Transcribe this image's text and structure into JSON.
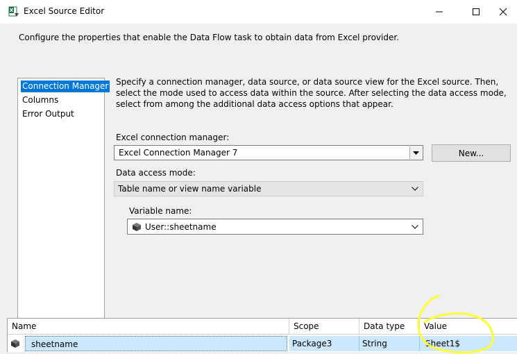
{
  "window": {
    "title": "Excel Source Editor",
    "app_icon": "excel-source-icon",
    "controls": [
      "minimize-icon",
      "maximize-icon",
      "close-icon"
    ]
  },
  "description": "Configure the properties that enable the Data Flow task to obtain data from Excel provider.",
  "nav": {
    "items": [
      {
        "label": "Connection Manager",
        "selected": true
      },
      {
        "label": "Columns",
        "selected": false
      },
      {
        "label": "Error Output",
        "selected": false
      }
    ]
  },
  "instructions": "Specify a connection manager, data source, or data source view for the Excel source. Then, select the mode used to access data within the source. After selecting the data access mode, select from among the additional data access options that appear.",
  "connection_manager": {
    "label": "Excel connection manager:",
    "value": "Excel Connection Manager 7",
    "new_button": "New..."
  },
  "data_access_mode": {
    "label": "Data access mode:",
    "value": "Table name or view name variable"
  },
  "variable": {
    "label": "Variable name:",
    "value": "User::sheetname",
    "icon": "variable-icon"
  },
  "variables_grid": {
    "columns": [
      "Name",
      "Scope",
      "Data type",
      "Value"
    ],
    "rows": [
      {
        "name": "sheetname",
        "scope": "Package3",
        "data_type": "String",
        "value": "Sheet1$",
        "icon": "variable-icon"
      }
    ]
  },
  "colors": {
    "selection": "#0078d7",
    "row_highlight": "#cce8ff",
    "annotation": "#ffff33"
  }
}
